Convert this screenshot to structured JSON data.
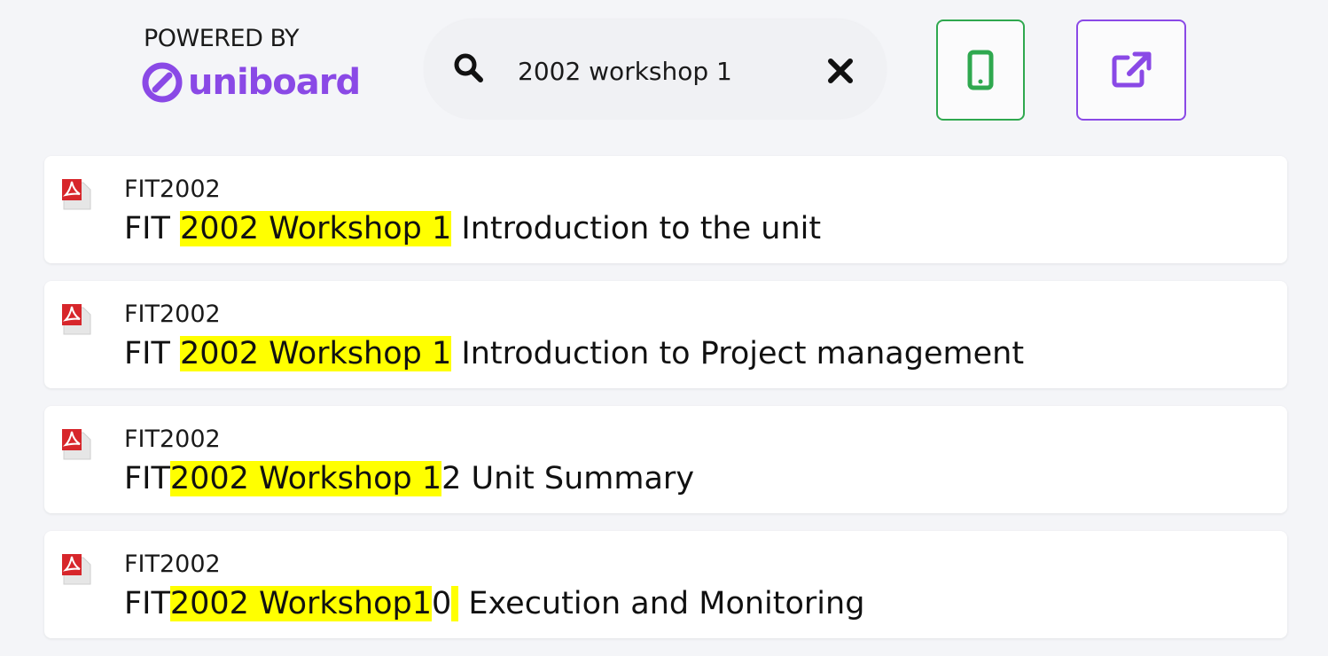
{
  "header": {
    "powered_by": "POWERED BY",
    "brand_name": "uniboard",
    "brand_color": "#8a49e6"
  },
  "search": {
    "value": "2002 workshop 1",
    "search_icon": "search-icon",
    "clear_icon": "close-icon"
  },
  "buttons": {
    "mobile": {
      "icon": "mobile-phone-icon",
      "color": "#2fa84f"
    },
    "open_external": {
      "icon": "external-link-icon",
      "color": "#8a49e6"
    }
  },
  "results": [
    {
      "icon": "pdf-icon",
      "unit": "FIT2002",
      "title_pre": "FIT ",
      "title_hl": "2002 Workshop 1",
      "title_post": " Introduction to the unit"
    },
    {
      "icon": "pdf-icon",
      "unit": "FIT2002",
      "title_pre": "FIT ",
      "title_hl": "2002 Workshop 1",
      "title_post": " Introduction to Project management"
    },
    {
      "icon": "pdf-icon",
      "unit": "FIT2002",
      "title_pre": "FIT",
      "title_hl": "2002 Workshop 1",
      "title_post": "2 Unit Summary"
    },
    {
      "icon": "pdf-icon",
      "unit": "FIT2002",
      "title_pre": "FIT",
      "title_hl": "2002 Workshop1",
      "title_mid": "0",
      "title_post": " Execution and Monitoring"
    }
  ],
  "highlight_color": "#ffff00"
}
